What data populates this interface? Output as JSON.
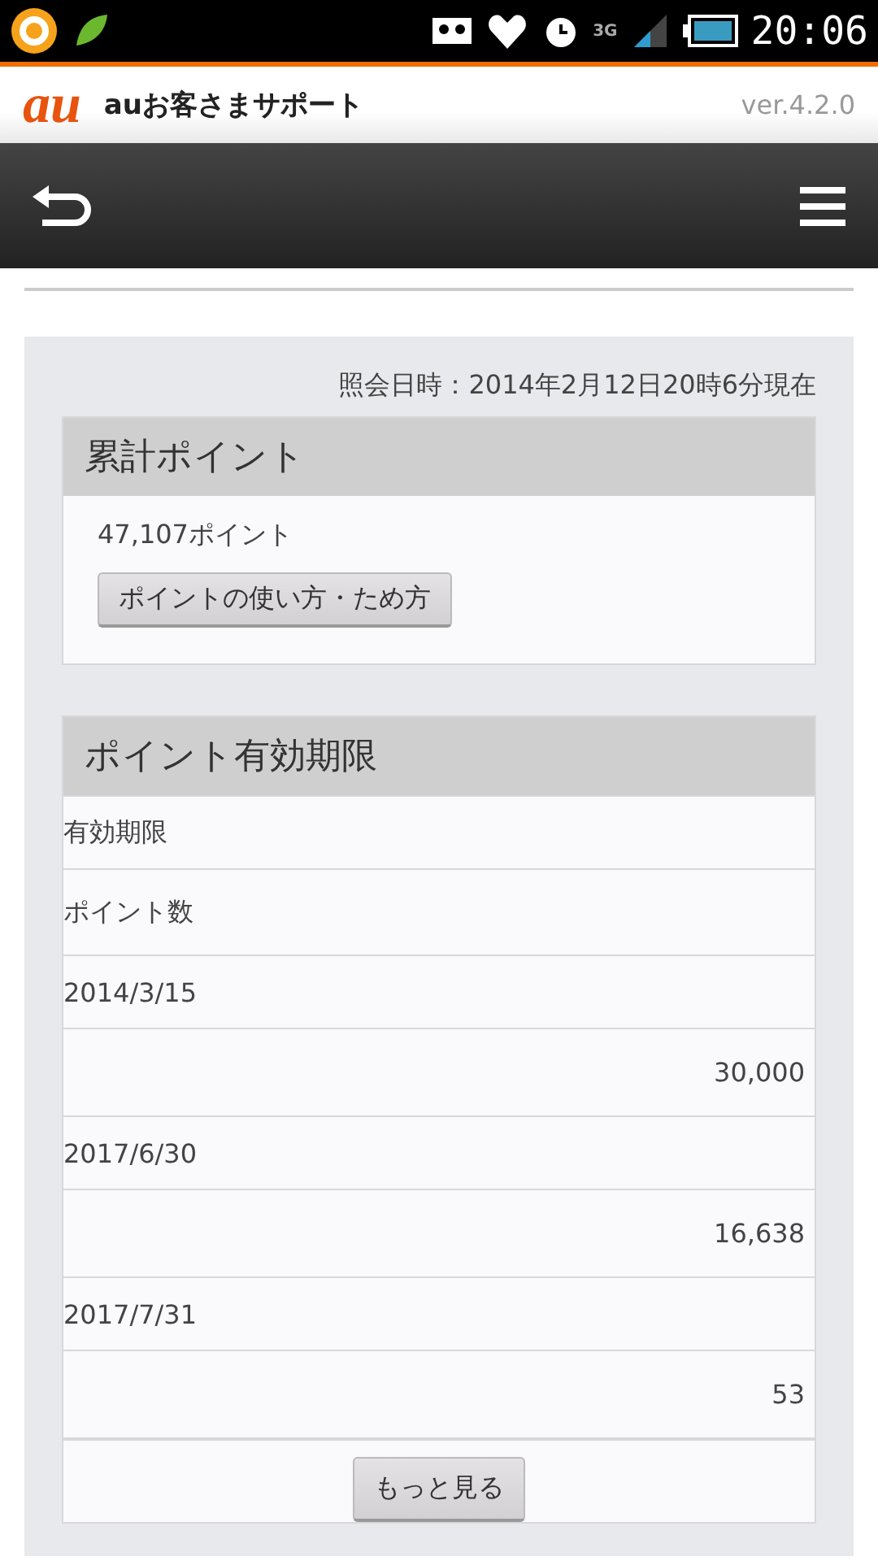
{
  "status_bar": {
    "time": "20:06",
    "network": "3G"
  },
  "header": {
    "logo": "au",
    "title": "auお客さまサポート",
    "version": "ver.4.2.0"
  },
  "timestamp": "照会日時：2014年2月12日20時6分現在",
  "total_points": {
    "title": "累計ポイント",
    "value": "47,107ポイント",
    "button": "ポイントの使い方・ため方"
  },
  "expiry": {
    "title": "ポイント有効期限",
    "column_headers": [
      "有効期限",
      "ポイント数"
    ],
    "rows": [
      {
        "date": "2014/3/15",
        "points": "30,000"
      },
      {
        "date": "2017/6/30",
        "points": "16,638"
      },
      {
        "date": "2017/7/31",
        "points": "53"
      }
    ],
    "more_button": "もっと見る"
  }
}
